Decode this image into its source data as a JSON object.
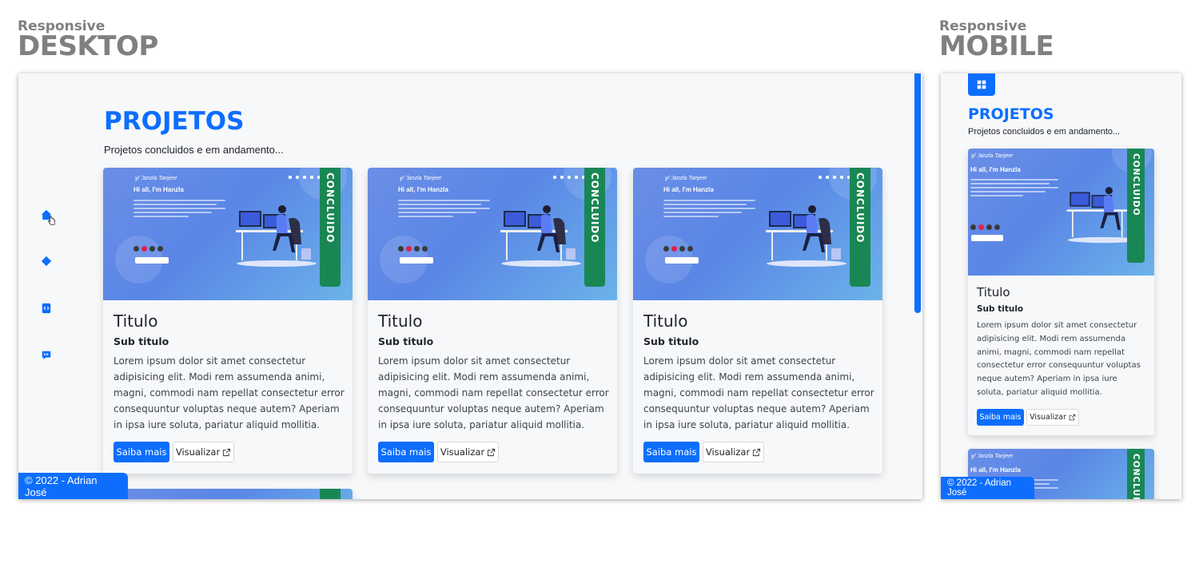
{
  "labels": {
    "desktop_small": "Responsive",
    "desktop_big": "DESKTOP",
    "mobile_small": "Responsive",
    "mobile_big": "MOBILE"
  },
  "page": {
    "title": "PROJETOS",
    "subtitle": "Projetos concluidos e em andamento...",
    "footer": "© 2022 - Adrian José"
  },
  "sidebar": {
    "icons": [
      "home-icon",
      "diamond-icon",
      "code-icon",
      "chat-quote-icon"
    ]
  },
  "preview": {
    "name": "Hi all, I'm Hanzla"
  },
  "cards": [
    {
      "status": "CONCLUIDO",
      "title": "Titulo",
      "subtitle": "Sub titulo",
      "body": "Lorem ipsum dolor sit amet consectetur adipisicing elit. Modi rem assumenda animi, magni, commodi nam repellat consectetur error consequuntur voluptas neque autem? Aperiam in ipsa iure soluta, pariatur aliquid mollitia.",
      "primary": "Saiba mais",
      "secondary": "Visualizar"
    },
    {
      "status": "CONCLUIDO",
      "title": "Titulo",
      "subtitle": "Sub titulo",
      "body": "Lorem ipsum dolor sit amet consectetur adipisicing elit. Modi rem assumenda animi, magni, commodi nam repellat consectetur error consequuntur voluptas neque autem? Aperiam in ipsa iure soluta, pariatur aliquid mollitia.",
      "primary": "Saiba mais",
      "secondary": "Visualizar"
    },
    {
      "status": "CONCLUIDO",
      "title": "Titulo",
      "subtitle": "Sub titulo",
      "body": "Lorem ipsum dolor sit amet consectetur adipisicing elit. Modi rem assumenda animi, magni, commodi nam repellat consectetur error consequuntur voluptas neque autem? Aperiam in ipsa iure soluta, pariatur aliquid mollitia.",
      "primary": "Saiba mais",
      "secondary": "Visualizar"
    }
  ],
  "mobile_card": {
    "status": "CONCLUIDO",
    "title": "Titulo",
    "subtitle": "Sub titulo",
    "body": "Lorem ipsum dolor sit amet consectetur adipisicing elit. Modi rem assumenda animi, magni, commodi nam repellat consectetur error consequuntur voluptas neque autem? Aperiam in ipsa iure soluta, pariatur aliquid mollitia.",
    "primary": "Saiba mais",
    "secondary": "Visualizar"
  },
  "colors": {
    "primary": "#0d6efd",
    "success": "#198754",
    "background": "#f7f8fa",
    "label_gray": "#808080"
  }
}
